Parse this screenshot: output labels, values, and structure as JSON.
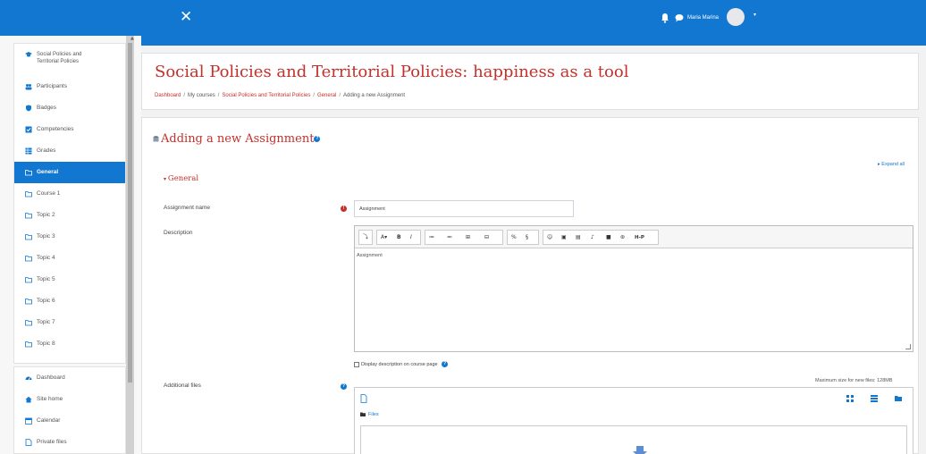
{
  "navbar": {
    "close_glyph": "✕",
    "user_name": "Maria Marina",
    "caret": "▾",
    "icons": [
      "bell-icon",
      "chat-icon",
      "avatar"
    ]
  },
  "sidebar": {
    "scroll_up": "▲",
    "course": {
      "label": "Social Policies and\nTerritorial Policies",
      "line1": "Social Policies and",
      "line2": "Territorial Policies",
      "icon": "graduation-cap-icon"
    },
    "items": [
      {
        "label": "Participants",
        "icon": "users-icon"
      },
      {
        "label": "Badges",
        "icon": "shield-icon"
      },
      {
        "label": "Competencies",
        "icon": "check-square-icon"
      },
      {
        "label": "Grades",
        "icon": "table-icon"
      },
      {
        "label": "General",
        "icon": "folder-icon",
        "active": true
      },
      {
        "label": "Course 1",
        "icon": "folder-icon"
      },
      {
        "label": "Topic 2",
        "icon": "folder-icon"
      },
      {
        "label": "Topic 3",
        "icon": "folder-icon"
      },
      {
        "label": "Topic 4",
        "icon": "folder-icon"
      },
      {
        "label": "Topic 5",
        "icon": "folder-icon"
      },
      {
        "label": "Topic 6",
        "icon": "folder-icon"
      },
      {
        "label": "Topic 7",
        "icon": "folder-icon"
      },
      {
        "label": "Topic 8",
        "icon": "folder-icon"
      }
    ],
    "global_items": [
      {
        "label": "Dashboard",
        "icon": "dashboard-icon"
      },
      {
        "label": "Site home",
        "icon": "home-icon"
      },
      {
        "label": "Calendar",
        "icon": "calendar-icon"
      },
      {
        "label": "Private files",
        "icon": "file-icon"
      }
    ]
  },
  "header": {
    "title": "Social Policies and Territorial Policies: happiness as a tool",
    "breadcrumb": [
      "Dashboard",
      "My courses",
      "Social Policies and Territorial Policies",
      "General",
      "Adding a new Assignment"
    ],
    "separator": "/"
  },
  "form": {
    "heading": "Adding a new Assignment",
    "help_glyph": "?",
    "required_glyph": "!",
    "expand_all": "Expand all",
    "section_general": "General",
    "assignment_name_label": "Assignment name",
    "assignment_name_value": "Assignment",
    "description_label": "Description",
    "description_value": "Assignment",
    "display_description_label": "Display description on course page",
    "additional_files_label": "Additional files",
    "max_size_text": "Maximum size for new files: 128MB",
    "files_path": "Files"
  },
  "toolbar": {
    "buttons": [
      {
        "label": "⤵",
        "name": "toggle-toolbar-button"
      },
      {
        "label": "A▾",
        "name": "font-style-button"
      },
      {
        "label": "B",
        "name": "bold-button"
      },
      {
        "label": "I",
        "name": "italic-button"
      },
      {
        "label": "≔",
        "name": "unordered-list-button"
      },
      {
        "label": "≕",
        "name": "ordered-list-button"
      },
      {
        "label": "⊞",
        "name": "indent-button"
      },
      {
        "label": "⊟",
        "name": "outdent-button"
      },
      {
        "label": "%",
        "name": "link-button"
      },
      {
        "label": "§",
        "name": "unlink-button"
      },
      {
        "label": "☺",
        "name": "emoticon-button"
      },
      {
        "label": "▣",
        "name": "image-button"
      },
      {
        "label": "▤",
        "name": "media-button"
      },
      {
        "label": "♪",
        "name": "record-audio-button"
      },
      {
        "label": "■",
        "name": "record-video-button"
      },
      {
        "label": "⊛",
        "name": "manage-files-button"
      },
      {
        "label": "H-P",
        "name": "h5p-button"
      }
    ]
  },
  "colors": {
    "primary": "#1177d1",
    "accent_red": "#c4302b"
  }
}
